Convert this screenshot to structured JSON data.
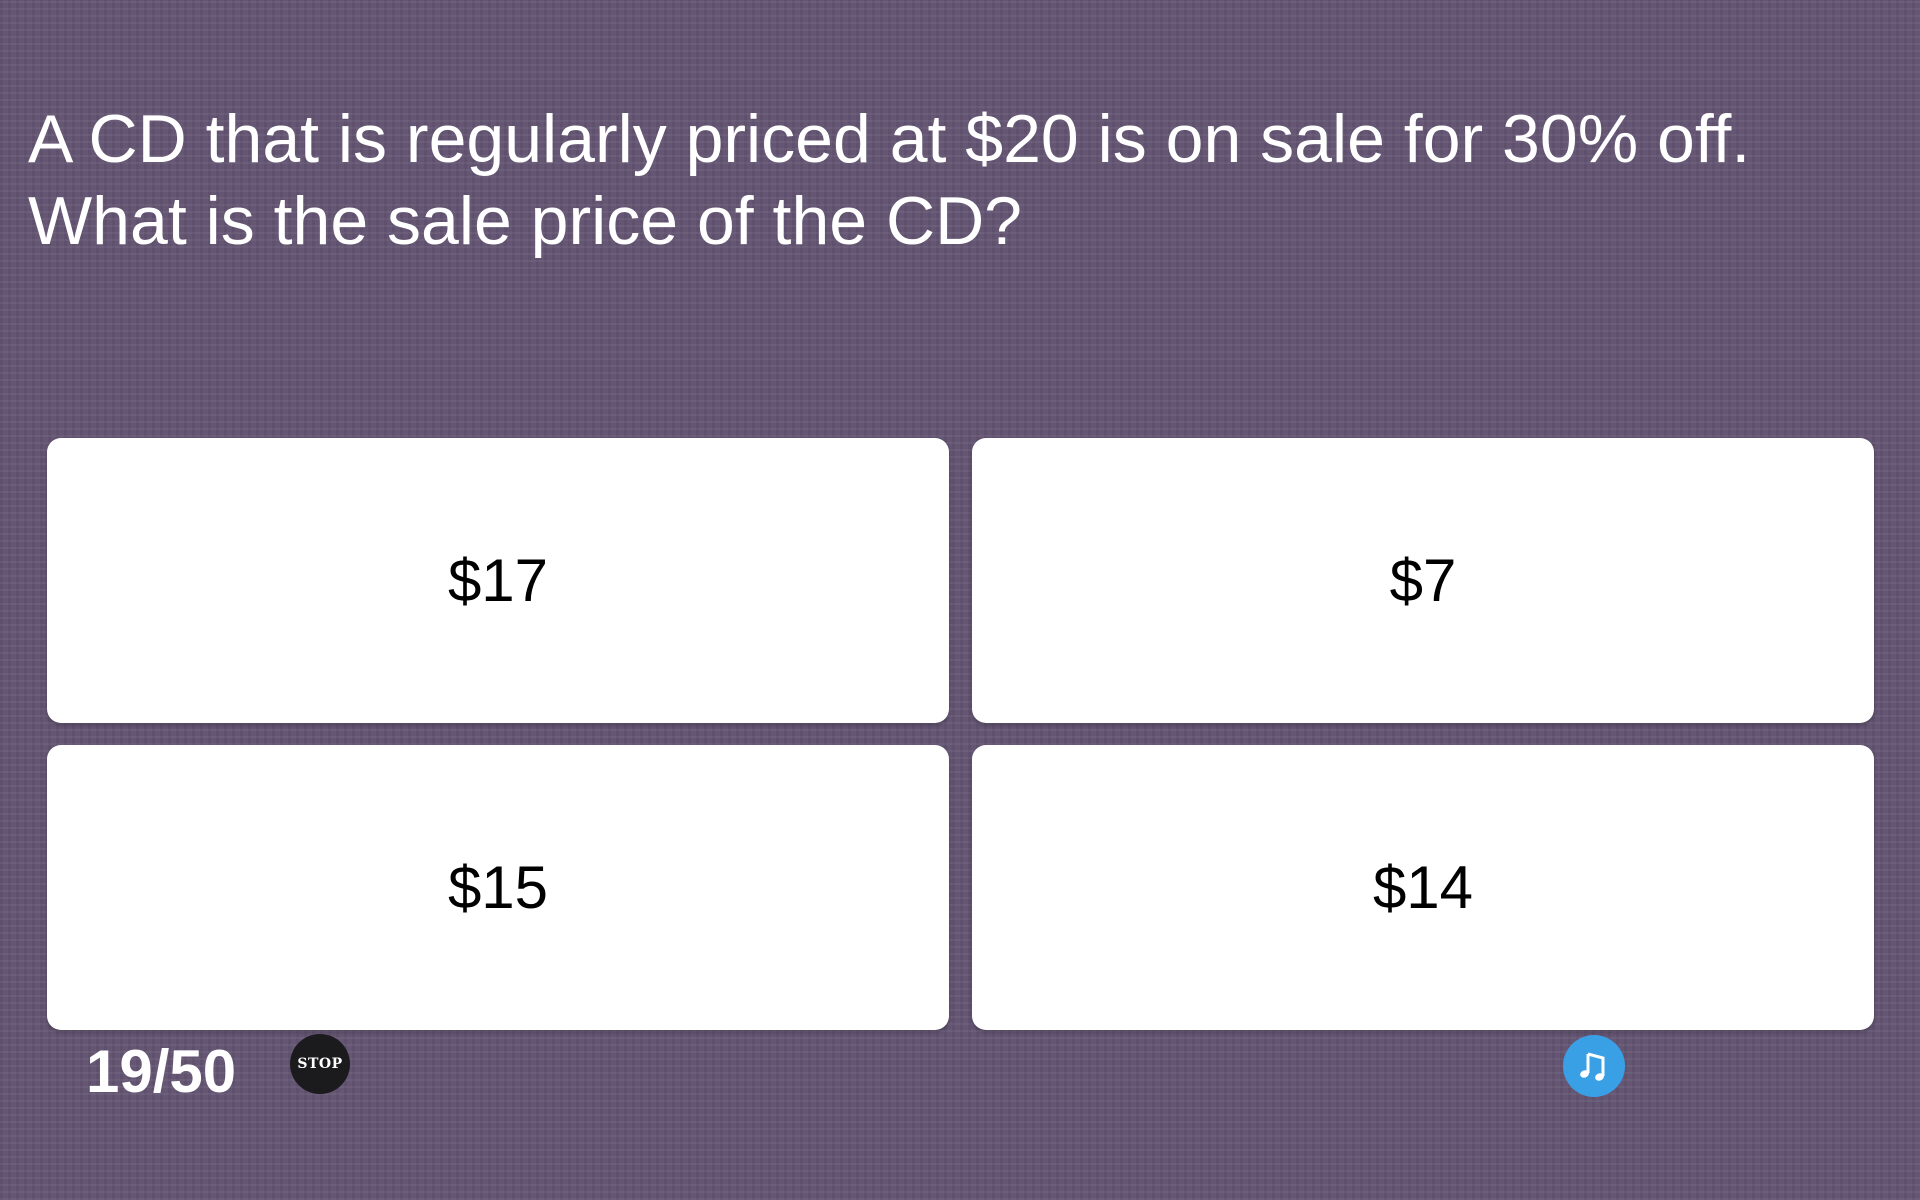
{
  "question": {
    "text": "A CD that is regularly priced at $20 is on sale for 30% off. What is the sale price of the CD?"
  },
  "answers": [
    {
      "label": "$17"
    },
    {
      "label": "$7"
    },
    {
      "label": "$15"
    },
    {
      "label": "$14"
    }
  ],
  "footer": {
    "progress": "19/50",
    "stop_label": "STOP",
    "music_icon": "music-note-icon"
  },
  "colors": {
    "background": "#655674",
    "card": "#ffffff",
    "stop_button": "#1b1a1c",
    "music_button": "#3aa0e6"
  }
}
